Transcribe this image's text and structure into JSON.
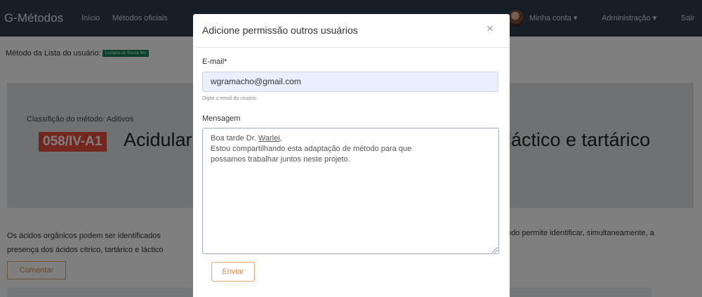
{
  "navbar": {
    "brand": "G-Métodos",
    "items": [
      "Início",
      "Métodos oficiais"
    ],
    "account": "Minha conta ▾",
    "admin": "Administração ▾",
    "logout": "Sair",
    "color": "#2c3e50"
  },
  "page": {
    "subtitle_label": "Método da Lista do usuário:",
    "owner_chip": "Luciana de Souza Mo",
    "classification": "Classifição do método: Aditivos",
    "code": "058/IV-A1",
    "title_left": "Acidular",
    "title_right": "láctico e tartárico",
    "description_left": "Os ácidos orgânicos podem ser identificados presença dos ácidos cítrico, tartárico e láctico",
    "description_right": "odo permite identificar, simultaneamente, a",
    "comment_button": "Comentar",
    "code_color": "#e74c3c"
  },
  "modal": {
    "title": "Adicione permissão outros usuários",
    "close_icon": "×",
    "email_label": "E-mail*",
    "email_value": "wgramacho@gmail.com",
    "email_help": "Digite o email do usuário",
    "message_label": "Mensagem",
    "message_lines": {
      "line1_prefix": "Boa tarde Dr. ",
      "line1_name": "Warlei",
      "line1_suffix": ",",
      "line2": "Estou compartilhando esta adaptação de método para que",
      "line3": "possamos trabalhar juntos neste projeto."
    },
    "send_button": "Enviar",
    "accent_color": "#e3a36a"
  }
}
